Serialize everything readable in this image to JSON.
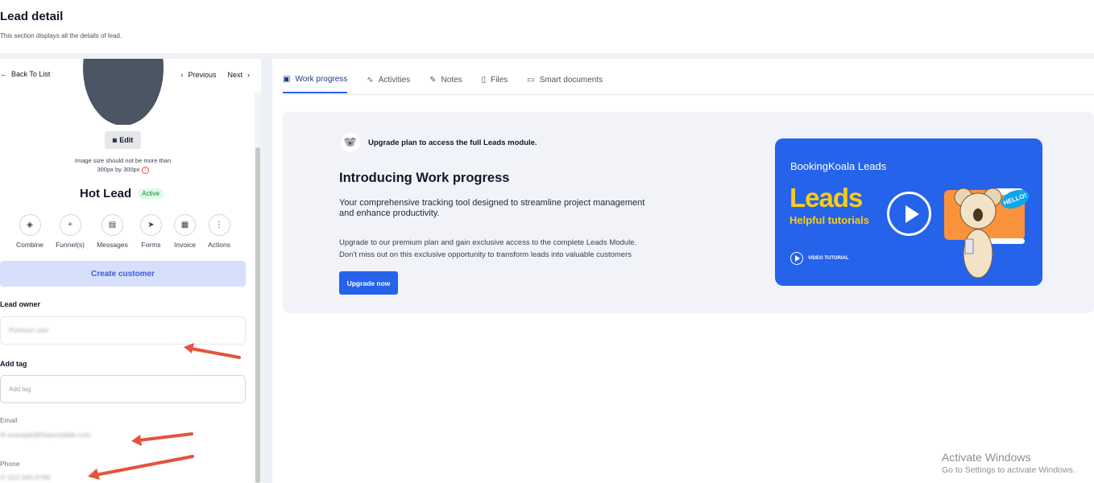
{
  "header": {
    "title": "Lead detail",
    "subtitle": "This section displays all the details of lead."
  },
  "nav": {
    "back": "Back To List",
    "previous": "Previous",
    "next": "Next"
  },
  "profile": {
    "edit_label": "Edit",
    "image_note_line1": "Image size should not be more than",
    "image_note_line2": "300px by 300px",
    "lead_name": "Hot Lead",
    "status": "Active"
  },
  "actions": [
    {
      "label": "Combine",
      "icon": "combine-icon",
      "glyph": "◈"
    },
    {
      "label": "Funnel(s)",
      "icon": "plus-icon",
      "glyph": "+"
    },
    {
      "label": "Messages",
      "icon": "message-icon",
      "glyph": "▤"
    },
    {
      "label": "Forms",
      "icon": "send-icon",
      "glyph": "➤"
    },
    {
      "label": "Invoice",
      "icon": "invoice-icon",
      "glyph": "▦"
    },
    {
      "label": "Actions",
      "icon": "more-icon",
      "glyph": "⋮"
    }
  ],
  "create_customer": "Create customer",
  "lead_owner": {
    "label": "Lead owner",
    "value": "Premium user"
  },
  "add_tag": {
    "label": "Add tag",
    "placeholder": "Add tag"
  },
  "email": {
    "label": "Email",
    "value": "example@thepostable.com"
  },
  "phone": {
    "label": "Phone",
    "value": "012-345-6789"
  },
  "tabs": [
    {
      "label": "Work progress",
      "icon": "chart-icon",
      "glyph": "▣",
      "active": true
    },
    {
      "label": "Activities",
      "icon": "activity-icon",
      "glyph": "∿",
      "active": false
    },
    {
      "label": "Notes",
      "icon": "notes-icon",
      "glyph": "✎",
      "active": false
    },
    {
      "label": "Files",
      "icon": "file-icon",
      "glyph": "▯",
      "active": false
    },
    {
      "label": "Smart documents",
      "icon": "document-icon",
      "glyph": "▭",
      "active": false
    }
  ],
  "promo": {
    "upgrade_notice": "Upgrade plan to access the full Leads module.",
    "title": "Introducing Work progress",
    "description": "Your comprehensive tracking tool designed to streamline project management and enhance productivity.",
    "detail_line1": "Upgrade to our premium plan and gain exclusive access to the complete Leads Module.",
    "detail_line2": "Don't miss out on this exclusive opportunity to transform leads into valuable customers",
    "button": "Upgrade now"
  },
  "video": {
    "brand": "BookingKoala Leads",
    "headline": "Leads",
    "subheadline": "Helpful tutorials",
    "badge": "VIDEO TUTORIAL",
    "bubble": "HELLO!"
  },
  "watermark": {
    "line1": "Activate Windows",
    "line2": "Go to Settings to activate Windows."
  },
  "colors": {
    "primary": "#2563eb",
    "accent_yellow": "#facc15",
    "active_badge": "#15803d",
    "annotation_arrow": "#e5533d"
  }
}
